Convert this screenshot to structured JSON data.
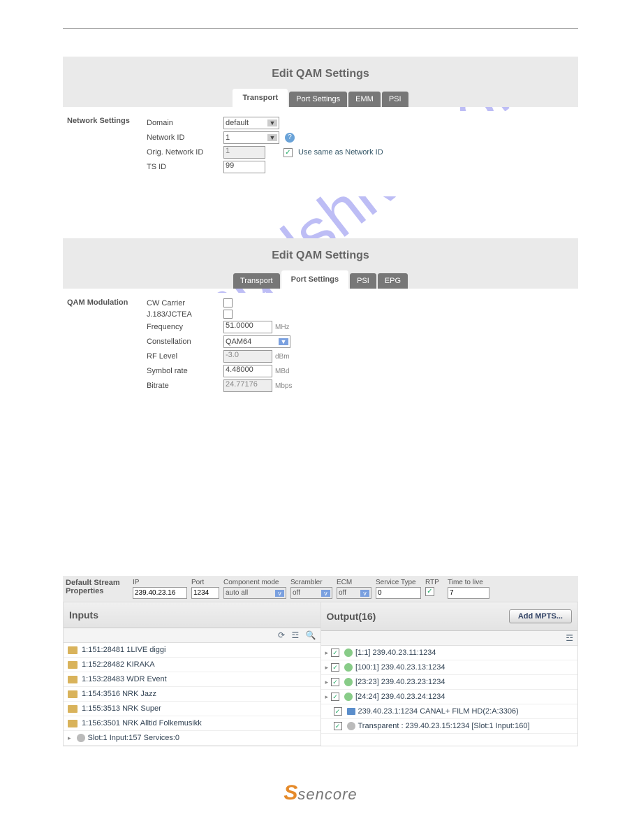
{
  "watermark": "manualshive.com",
  "panel1": {
    "title": "Edit QAM Settings",
    "tabs": [
      "Transport",
      "Port Settings",
      "EMM",
      "PSI"
    ],
    "active_tab": 0,
    "section": "Network Settings",
    "rows": {
      "domain_label": "Domain",
      "domain_value": "default",
      "network_id_label": "Network ID",
      "network_id_value": "1",
      "orig_network_id_label": "Orig. Network ID",
      "orig_network_id_value": "1",
      "orig_checkbox_checked": true,
      "orig_checkbox_label": "Use same as Network ID",
      "ts_id_label": "TS ID",
      "ts_id_value": "99"
    }
  },
  "panel2": {
    "title": "Edit QAM Settings",
    "tabs": [
      "Transport",
      "Port Settings",
      "PSI",
      "EPG"
    ],
    "active_tab": 1,
    "section": "QAM Modulation",
    "rows": {
      "cw_label": "CW Carrier",
      "j83_label": "J.183/JCTEA",
      "freq_label": "Frequency",
      "freq_value": "51.0000",
      "freq_unit": "MHz",
      "const_label": "Constellation",
      "const_value": "QAM64",
      "rf_label": "RF Level",
      "rf_value": "-3.0",
      "rf_unit": "dBm",
      "sym_label": "Symbol rate",
      "sym_value": "4.48000",
      "sym_unit": "MBd",
      "bit_label": "Bitrate",
      "bit_value": "24.77176",
      "bit_unit": "Mbps"
    }
  },
  "panel3": {
    "label": "Default Stream Properties",
    "ip_label": "IP",
    "ip_value": "239.40.23.16",
    "port_label": "Port",
    "port_value": "1234",
    "comp_label": "Component mode",
    "comp_value": "auto all",
    "scrambler_label": "Scrambler",
    "scrambler_value": "off",
    "ecm_label": "ECM",
    "ecm_value": "off",
    "service_label": "Service Type",
    "service_value": "0",
    "rtp_label": "RTP",
    "rtp_checked": true,
    "ttl_label": "Time to live",
    "ttl_value": "7",
    "inputs_title": "Inputs",
    "output_title": "Output(16)",
    "add_mpts": "Add MPTS...",
    "inputs": [
      "1:151:28481 1LIVE diggi",
      "1:152:28482 KIRAKA",
      "1:153:28483 WDR Event",
      "1:154:3516 NRK Jazz",
      "1:155:3513 NRK Super",
      "1:156:3501 NRK Alltid Folkemusikk"
    ],
    "inputs_summary": "Slot:1 Input:157 Services:0",
    "outputs": [
      {
        "text": "[1:1] 239.40.23.11:1234",
        "expand": true,
        "globe": true
      },
      {
        "text": "[100:1] 239.40.23.13:1234",
        "expand": true,
        "globe": true
      },
      {
        "text": "[23:23] 239.40.23.23:1234",
        "expand": true,
        "globe": true
      },
      {
        "text": "[24:24] 239.40.23.24:1234",
        "expand": true,
        "globe": true
      },
      {
        "text": "239.40.23.1:1234 CANAL+ FILM HD(2:A:3306)",
        "expand": false,
        "tvicon": true
      },
      {
        "text": "Transparent : 239.40.23.15:1234 [Slot:1 Input:160]",
        "expand": false,
        "globe_gray": true
      }
    ]
  },
  "footer": {
    "brand": "sencore"
  }
}
